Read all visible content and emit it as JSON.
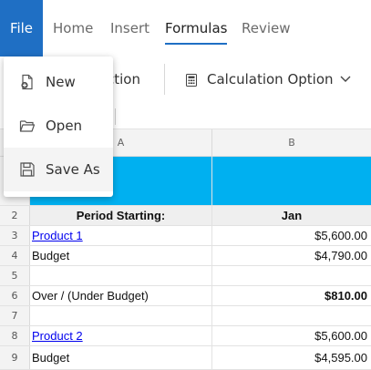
{
  "ribbon": {
    "tabs": [
      {
        "label": "File",
        "active": false
      },
      {
        "label": "Home",
        "active": false
      },
      {
        "label": "Insert",
        "active": false
      },
      {
        "label": "Formulas",
        "active": true
      },
      {
        "label": "Review",
        "active": false
      }
    ]
  },
  "toolbar": {
    "partial_button_label": "ction",
    "calculation_option_label": "Calculation Option"
  },
  "file_menu": {
    "items": [
      {
        "label": "New",
        "icon": "new-file-icon"
      },
      {
        "label": "Open",
        "icon": "folder-open-icon"
      },
      {
        "label": "Save As",
        "icon": "save-icon"
      }
    ]
  },
  "grid": {
    "columns": [
      "A",
      "B"
    ],
    "rows": [
      {
        "num": "",
        "a": "",
        "b": ""
      },
      {
        "num": "2",
        "a": "Period Starting:",
        "b": "Jan"
      },
      {
        "num": "3",
        "a": "Product 1",
        "b": "$5,600.00"
      },
      {
        "num": "4",
        "a": "Budget",
        "b": "$4,790.00"
      },
      {
        "num": "5",
        "a": "",
        "b": ""
      },
      {
        "num": "6",
        "a": "Over / (Under Budget)",
        "b": "$810.00"
      },
      {
        "num": "7",
        "a": "",
        "b": ""
      },
      {
        "num": "8",
        "a": "Product 2",
        "b": "$5,600.00"
      },
      {
        "num": "9",
        "a": "Budget",
        "b": "$4,595.00"
      }
    ]
  },
  "colors": {
    "accent": "#1f6fc4",
    "header_fill": "#00b0f0",
    "link": "#0000ee"
  }
}
